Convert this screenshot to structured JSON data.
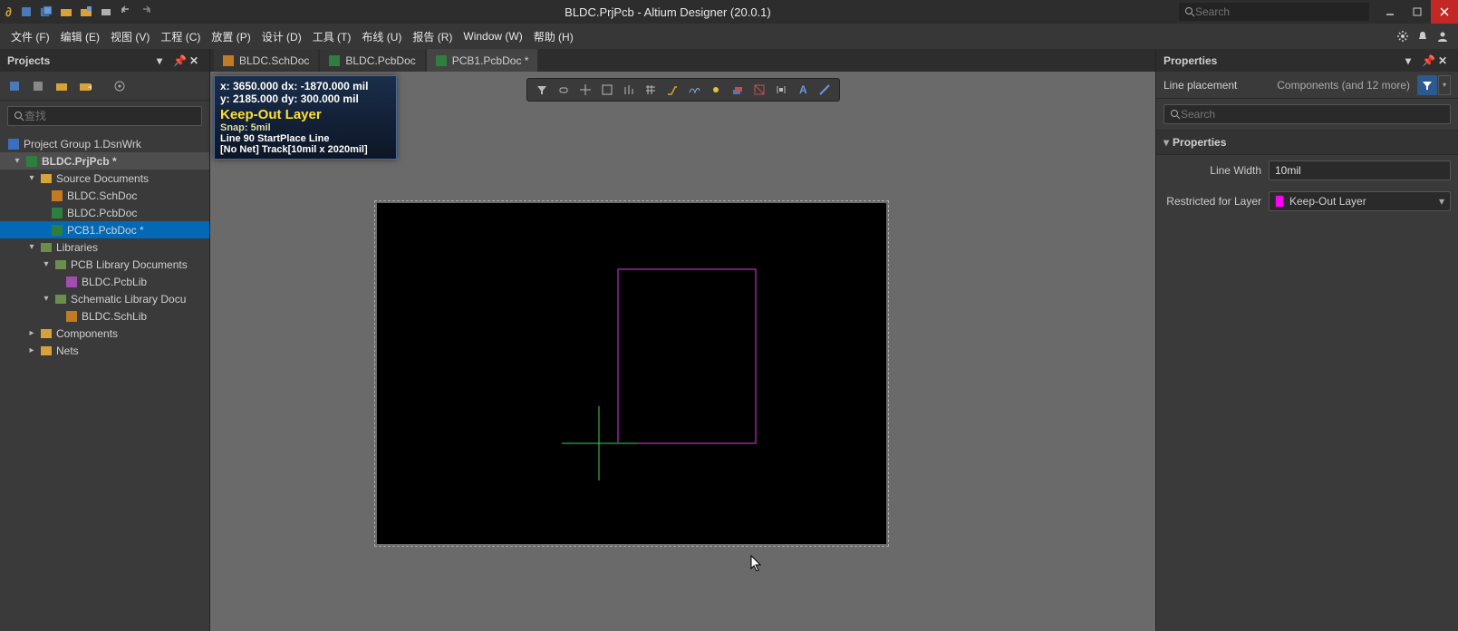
{
  "titlebar": {
    "title": "BLDC.PrjPcb - Altium Designer (20.0.1)",
    "search_placeholder": "Search"
  },
  "menubar": {
    "items": [
      "文件 (F)",
      "编辑 (E)",
      "视图 (V)",
      "工程 (C)",
      "放置 (P)",
      "设计 (D)",
      "工具 (T)",
      "布线 (U)",
      "报告 (R)",
      "Window (W)",
      "帮助 (H)"
    ]
  },
  "projects": {
    "title": "Projects",
    "search_placeholder": "查找",
    "tree": {
      "group": "Project Group 1.DsnWrk",
      "project": "BLDC.PrjPcb *",
      "src_folder": "Source Documents",
      "src": [
        "BLDC.SchDoc",
        "BLDC.PcbDoc",
        "PCB1.PcbDoc *"
      ],
      "lib_folder": "Libraries",
      "pcb_lib_folder": "PCB Library Documents",
      "pcb_lib": [
        "BLDC.PcbLib"
      ],
      "sch_lib_folder": "Schematic Library Docu",
      "sch_lib": [
        "BLDC.SchLib"
      ],
      "components": "Components",
      "nets": "Nets"
    }
  },
  "tabs": [
    {
      "label": "BLDC.SchDoc",
      "kind": "sch",
      "active": false
    },
    {
      "label": "BLDC.PcbDoc",
      "kind": "pcb",
      "active": false
    },
    {
      "label": "PCB1.PcbDoc *",
      "kind": "pcb",
      "active": true
    }
  ],
  "headsup": {
    "line1": "x:  3650.000    dx: -1870.000 mil",
    "line2": "y:  2185.000    dy:    300.000  mil",
    "layer": "Keep-Out Layer",
    "snap": "Snap: 5mil",
    "status": "Line 90 StartPlace Line",
    "track": "[No Net] Track[10mil x 2020mil]"
  },
  "properties": {
    "title": "Properties",
    "mode_left": "Line placement",
    "mode_right": "Components (and 12 more)",
    "search_placeholder": "Search",
    "section": "Properties",
    "line_width_label": "Line Width",
    "line_width_value": "10mil",
    "restrict_label": "Restricted for Layer",
    "restrict_value": "Keep-Out Layer"
  },
  "colors": {
    "keepout": "#c028c0",
    "cursor": "#39d353"
  }
}
